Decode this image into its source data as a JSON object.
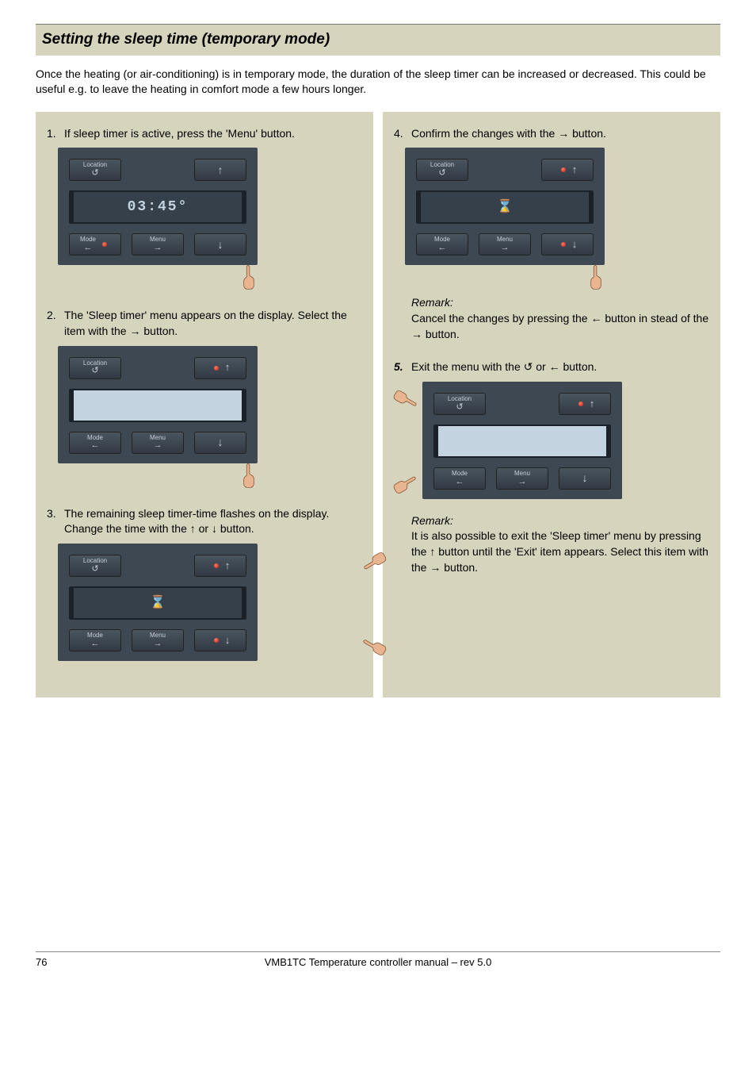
{
  "page": {
    "title": "Setting the sleep time (temporary mode)",
    "intro": "Once the heating (or air-conditioning) is in temporary mode, the duration of the sleep timer can be increased or decreased. This could be useful e.g. to leave the heating in comfort mode a few hours longer."
  },
  "panel_labels": {
    "location": "Location",
    "mode": "Mode",
    "menu": "Menu"
  },
  "symbols": {
    "loop": "↺",
    "left": "←",
    "right": "→",
    "up": "↑",
    "down": "↓",
    "hourglass": "⌛"
  },
  "lcd": {
    "step1": "03:45°",
    "step3": "⌛",
    "step4": "⌛"
  },
  "left_steps": [
    {
      "num": "1.",
      "text": "If sleep timer is active, press the 'Menu' button."
    },
    {
      "num": "2.",
      "text": "The 'Sleep timer' menu appears on the display. Select the item with the → button."
    },
    {
      "num": "3.",
      "text": "The remaining sleep timer-time flashes on the display.",
      "text2": "Change the time with the ↑ or ↓ button."
    }
  ],
  "right_steps": [
    {
      "num": "4.",
      "text": "Confirm the changes with the → button."
    },
    {
      "num": "5.",
      "text": "Exit the menu with the ↺ or ← button.",
      "bold": true
    }
  ],
  "remarks": {
    "r1_label": "Remark:",
    "r1_text": "Cancel the changes by pressing the ← button in stead of the → button.",
    "r2_label": "Remark:",
    "r2_text": "It is also possible to exit the 'Sleep timer' menu by pressing the ↑ button until the 'Exit' item appears. Select this item with the → button."
  },
  "footer": {
    "page_number": "76",
    "doc_title": "VMB1TC Temperature controller manual – rev 5.0"
  }
}
